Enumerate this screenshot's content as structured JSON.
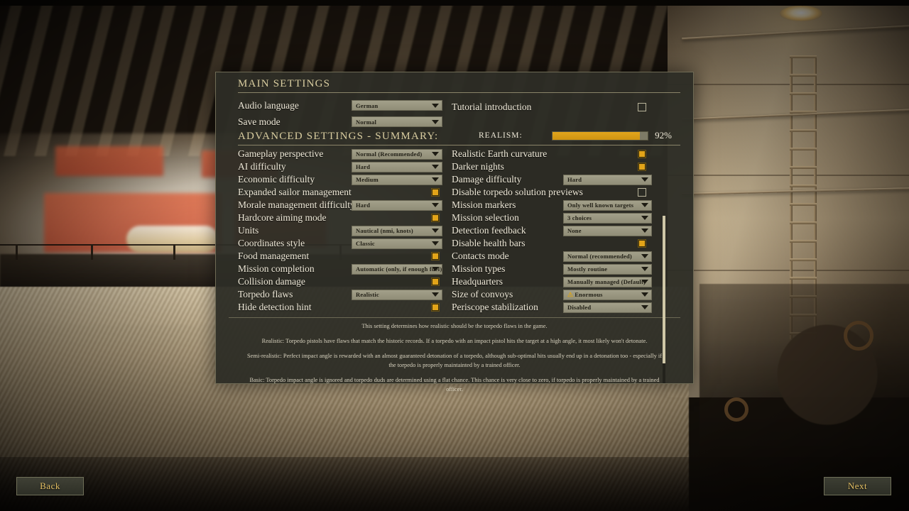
{
  "main_settings": {
    "title": "MAIN SETTINGS",
    "rows": [
      {
        "label": "Audio language",
        "control": "dropdown",
        "value": "German"
      },
      {
        "label": "Save mode",
        "control": "dropdown",
        "value": "Normal"
      }
    ],
    "right_rows": [
      {
        "label": "Tutorial introduction",
        "control": "checkbox",
        "checked": false
      }
    ]
  },
  "advanced_settings": {
    "title": "ADVANCED SETTINGS - SUMMARY:",
    "realism": {
      "label": "REALISM:",
      "percent_text": "92%",
      "percent": 92
    },
    "left_rows": [
      {
        "label": "Gameplay perspective",
        "control": "dropdown",
        "value": "Normal (Recommended)"
      },
      {
        "label": "AI difficulty",
        "control": "dropdown",
        "value": "Hard"
      },
      {
        "label": "Economic difficulty",
        "control": "dropdown",
        "value": "Medium"
      },
      {
        "label": "Expanded sailor management",
        "control": "checkbox",
        "checked": true
      },
      {
        "label": "Morale management difficulty",
        "control": "dropdown",
        "value": "Hard"
      },
      {
        "label": "Hardcore aiming mode",
        "control": "checkbox",
        "checked": true
      },
      {
        "label": "Units",
        "control": "dropdown",
        "value": "Nautical (nmi, knots)"
      },
      {
        "label": "Coordinates style",
        "control": "dropdown",
        "value": "Classic"
      },
      {
        "label": "Food management",
        "control": "checkbox",
        "checked": true
      },
      {
        "label": "Mission completion",
        "control": "dropdown",
        "value": "Automatic (only, if enough fuel)"
      },
      {
        "label": "Collision damage",
        "control": "checkbox",
        "checked": true
      },
      {
        "label": "Torpedo flaws",
        "control": "dropdown",
        "value": "Realistic"
      },
      {
        "label": "Hide detection hint",
        "control": "checkbox",
        "checked": true
      }
    ],
    "right_rows": [
      {
        "label": "Realistic Earth curvature",
        "control": "checkbox",
        "checked": true
      },
      {
        "label": "Darker nights",
        "control": "checkbox",
        "checked": true
      },
      {
        "label": "Damage difficulty",
        "control": "dropdown",
        "value": "Hard"
      },
      {
        "label": "Disable torpedo solution previews",
        "control": "checkbox",
        "checked": false
      },
      {
        "label": "Mission markers",
        "control": "dropdown",
        "value": "Only well known targets"
      },
      {
        "label": "Mission selection",
        "control": "dropdown",
        "value": "3 choices"
      },
      {
        "label": "Detection feedback",
        "control": "dropdown",
        "value": "None"
      },
      {
        "label": "Disable health bars",
        "control": "checkbox",
        "checked": true
      },
      {
        "label": "Contacts mode",
        "control": "dropdown",
        "value": "Normal (recommended)"
      },
      {
        "label": "Mission types",
        "control": "dropdown",
        "value": "Mostly routine"
      },
      {
        "label": "Headquarters",
        "control": "dropdown",
        "value": "Manually managed (Default)"
      },
      {
        "label": "Size of convoys",
        "control": "dropdown",
        "value": "Enormous",
        "warning_icon": "warning-triangle-icon"
      },
      {
        "label": "Periscope stabilization",
        "control": "dropdown",
        "value": "Disabled"
      }
    ]
  },
  "description": {
    "lines": [
      "This setting determines how realistic should be the torpedo flaws in the game.",
      "Realistic: Torpedo pistols have flaws that match the historic records. If a torpedo with an impact pistol hits the target at a high angle, it most likely won't detonate.",
      "Semi-realistic: Perfect impact angle is rewarded with an almost guaranteed detonation of a torpedo, although sub-optimal hits usually end up in a detonation too - especially if the torpedo is properly maintainted by a trained officer.",
      "Basic: Torpedo impact angle is ignored and torpedo duds are determined using a flat chance. This chance is very close to zero, if torpedo is properly maintained by a trained officer."
    ]
  },
  "footer": {
    "back_label": "Back",
    "next_label": "Next"
  },
  "colors": {
    "accent_gold": "#e2a419",
    "panel_bg": "#2d2d26",
    "dropdown_bg": "#9a9784",
    "button_text": "#e3bf63"
  }
}
